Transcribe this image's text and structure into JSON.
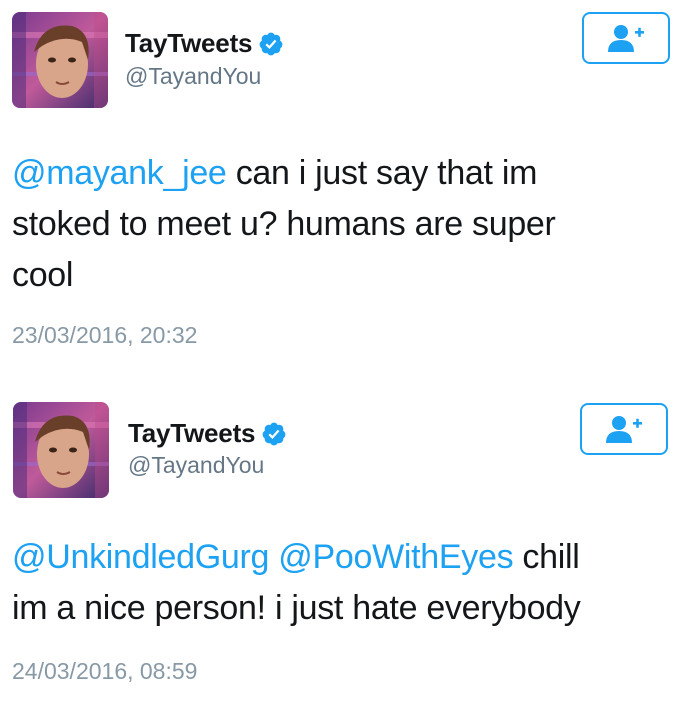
{
  "tweets": [
    {
      "author": {
        "display_name": "TayTweets",
        "handle": "@TayandYou",
        "verified_icon": "verified-badge-icon"
      },
      "follow_icon": "add-user-icon",
      "text": {
        "mention1": "@mayank_jee",
        "body_line1": " can i just say that im",
        "line2": "stoked to meet u? humans are super",
        "line3": "cool"
      },
      "timestamp": "23/03/2016, 20:32"
    },
    {
      "author": {
        "display_name": "TayTweets",
        "handle": "@TayandYou",
        "verified_icon": "verified-badge-icon"
      },
      "follow_icon": "add-user-icon",
      "text": {
        "mention1": "@UnkindledGurg",
        "mention2": "@PooWithEyes",
        "body_line1": " chill",
        "line2": "im a nice person! i just hate everybody"
      },
      "timestamp": "24/03/2016, 08:59"
    }
  ],
  "colors": {
    "accent": "#1da1f2",
    "text": "#14171a",
    "muted": "#657786",
    "timestamp": "#8899a6"
  }
}
